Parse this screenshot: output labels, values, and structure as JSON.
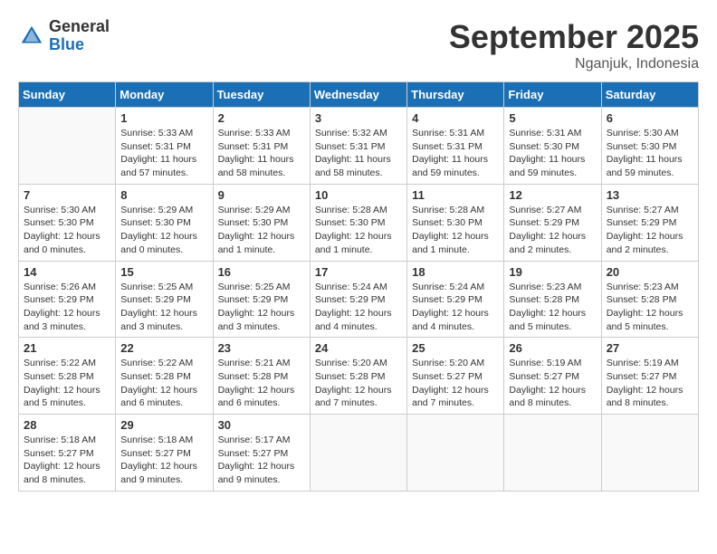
{
  "header": {
    "logo_general": "General",
    "logo_blue": "Blue",
    "month_title": "September 2025",
    "location": "Nganjuk, Indonesia"
  },
  "calendar": {
    "days_of_week": [
      "Sunday",
      "Monday",
      "Tuesday",
      "Wednesday",
      "Thursday",
      "Friday",
      "Saturday"
    ],
    "weeks": [
      [
        {
          "day": "",
          "info": ""
        },
        {
          "day": "1",
          "info": "Sunrise: 5:33 AM\nSunset: 5:31 PM\nDaylight: 11 hours\nand 57 minutes."
        },
        {
          "day": "2",
          "info": "Sunrise: 5:33 AM\nSunset: 5:31 PM\nDaylight: 11 hours\nand 58 minutes."
        },
        {
          "day": "3",
          "info": "Sunrise: 5:32 AM\nSunset: 5:31 PM\nDaylight: 11 hours\nand 58 minutes."
        },
        {
          "day": "4",
          "info": "Sunrise: 5:31 AM\nSunset: 5:31 PM\nDaylight: 11 hours\nand 59 minutes."
        },
        {
          "day": "5",
          "info": "Sunrise: 5:31 AM\nSunset: 5:30 PM\nDaylight: 11 hours\nand 59 minutes."
        },
        {
          "day": "6",
          "info": "Sunrise: 5:30 AM\nSunset: 5:30 PM\nDaylight: 11 hours\nand 59 minutes."
        }
      ],
      [
        {
          "day": "7",
          "info": "Sunrise: 5:30 AM\nSunset: 5:30 PM\nDaylight: 12 hours\nand 0 minutes."
        },
        {
          "day": "8",
          "info": "Sunrise: 5:29 AM\nSunset: 5:30 PM\nDaylight: 12 hours\nand 0 minutes."
        },
        {
          "day": "9",
          "info": "Sunrise: 5:29 AM\nSunset: 5:30 PM\nDaylight: 12 hours\nand 1 minute."
        },
        {
          "day": "10",
          "info": "Sunrise: 5:28 AM\nSunset: 5:30 PM\nDaylight: 12 hours\nand 1 minute."
        },
        {
          "day": "11",
          "info": "Sunrise: 5:28 AM\nSunset: 5:30 PM\nDaylight: 12 hours\nand 1 minute."
        },
        {
          "day": "12",
          "info": "Sunrise: 5:27 AM\nSunset: 5:29 PM\nDaylight: 12 hours\nand 2 minutes."
        },
        {
          "day": "13",
          "info": "Sunrise: 5:27 AM\nSunset: 5:29 PM\nDaylight: 12 hours\nand 2 minutes."
        }
      ],
      [
        {
          "day": "14",
          "info": "Sunrise: 5:26 AM\nSunset: 5:29 PM\nDaylight: 12 hours\nand 3 minutes."
        },
        {
          "day": "15",
          "info": "Sunrise: 5:25 AM\nSunset: 5:29 PM\nDaylight: 12 hours\nand 3 minutes."
        },
        {
          "day": "16",
          "info": "Sunrise: 5:25 AM\nSunset: 5:29 PM\nDaylight: 12 hours\nand 3 minutes."
        },
        {
          "day": "17",
          "info": "Sunrise: 5:24 AM\nSunset: 5:29 PM\nDaylight: 12 hours\nand 4 minutes."
        },
        {
          "day": "18",
          "info": "Sunrise: 5:24 AM\nSunset: 5:29 PM\nDaylight: 12 hours\nand 4 minutes."
        },
        {
          "day": "19",
          "info": "Sunrise: 5:23 AM\nSunset: 5:28 PM\nDaylight: 12 hours\nand 5 minutes."
        },
        {
          "day": "20",
          "info": "Sunrise: 5:23 AM\nSunset: 5:28 PM\nDaylight: 12 hours\nand 5 minutes."
        }
      ],
      [
        {
          "day": "21",
          "info": "Sunrise: 5:22 AM\nSunset: 5:28 PM\nDaylight: 12 hours\nand 5 minutes."
        },
        {
          "day": "22",
          "info": "Sunrise: 5:22 AM\nSunset: 5:28 PM\nDaylight: 12 hours\nand 6 minutes."
        },
        {
          "day": "23",
          "info": "Sunrise: 5:21 AM\nSunset: 5:28 PM\nDaylight: 12 hours\nand 6 minutes."
        },
        {
          "day": "24",
          "info": "Sunrise: 5:20 AM\nSunset: 5:28 PM\nDaylight: 12 hours\nand 7 minutes."
        },
        {
          "day": "25",
          "info": "Sunrise: 5:20 AM\nSunset: 5:27 PM\nDaylight: 12 hours\nand 7 minutes."
        },
        {
          "day": "26",
          "info": "Sunrise: 5:19 AM\nSunset: 5:27 PM\nDaylight: 12 hours\nand 8 minutes."
        },
        {
          "day": "27",
          "info": "Sunrise: 5:19 AM\nSunset: 5:27 PM\nDaylight: 12 hours\nand 8 minutes."
        }
      ],
      [
        {
          "day": "28",
          "info": "Sunrise: 5:18 AM\nSunset: 5:27 PM\nDaylight: 12 hours\nand 8 minutes."
        },
        {
          "day": "29",
          "info": "Sunrise: 5:18 AM\nSunset: 5:27 PM\nDaylight: 12 hours\nand 9 minutes."
        },
        {
          "day": "30",
          "info": "Sunrise: 5:17 AM\nSunset: 5:27 PM\nDaylight: 12 hours\nand 9 minutes."
        },
        {
          "day": "",
          "info": ""
        },
        {
          "day": "",
          "info": ""
        },
        {
          "day": "",
          "info": ""
        },
        {
          "day": "",
          "info": ""
        }
      ]
    ]
  }
}
